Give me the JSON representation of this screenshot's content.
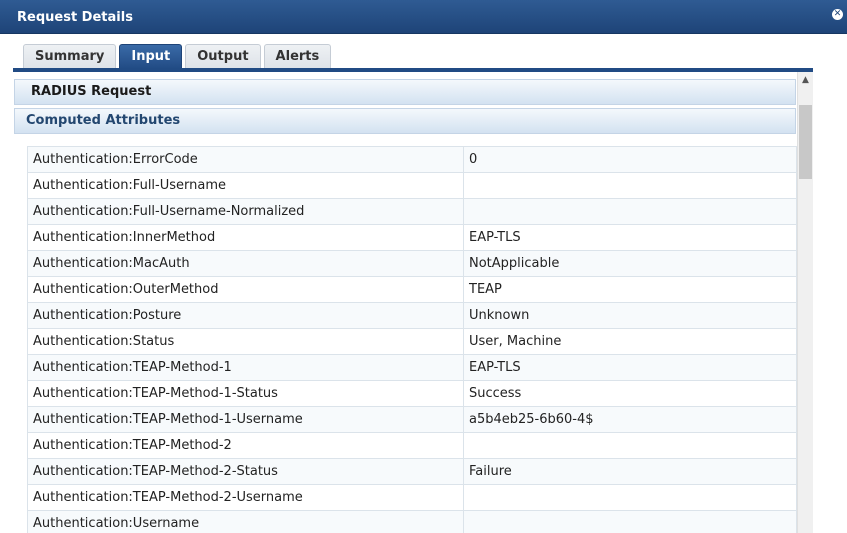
{
  "window": {
    "title": "Request Details",
    "close_icon": "✕"
  },
  "tabs": [
    {
      "label": "Summary",
      "active": false
    },
    {
      "label": "Input",
      "active": true
    },
    {
      "label": "Output",
      "active": false
    },
    {
      "label": "Alerts",
      "active": false
    }
  ],
  "sections": {
    "radius": "RADIUS Request",
    "computed": "Computed Attributes"
  },
  "attributes": [
    {
      "name": "Authentication:ErrorCode",
      "value": "0"
    },
    {
      "name": "Authentication:Full-Username",
      "value": ""
    },
    {
      "name": "Authentication:Full-Username-Normalized",
      "value": ""
    },
    {
      "name": "Authentication:InnerMethod",
      "value": "EAP-TLS"
    },
    {
      "name": "Authentication:MacAuth",
      "value": "NotApplicable"
    },
    {
      "name": "Authentication:OuterMethod",
      "value": "TEAP"
    },
    {
      "name": "Authentication:Posture",
      "value": "Unknown"
    },
    {
      "name": "Authentication:Status",
      "value": "User, Machine"
    },
    {
      "name": "Authentication:TEAP-Method-1",
      "value": "EAP-TLS"
    },
    {
      "name": "Authentication:TEAP-Method-1-Status",
      "value": "Success"
    },
    {
      "name": "Authentication:TEAP-Method-1-Username",
      "value": "a5b4eb25-6b60-4$"
    },
    {
      "name": "Authentication:TEAP-Method-2",
      "value": ""
    },
    {
      "name": "Authentication:TEAP-Method-2-Status",
      "value": "Failure"
    },
    {
      "name": "Authentication:TEAP-Method-2-Username",
      "value": ""
    },
    {
      "name": "Authentication:Username",
      "value": ""
    }
  ],
  "scrollbar": {
    "up_icon": "▲"
  }
}
